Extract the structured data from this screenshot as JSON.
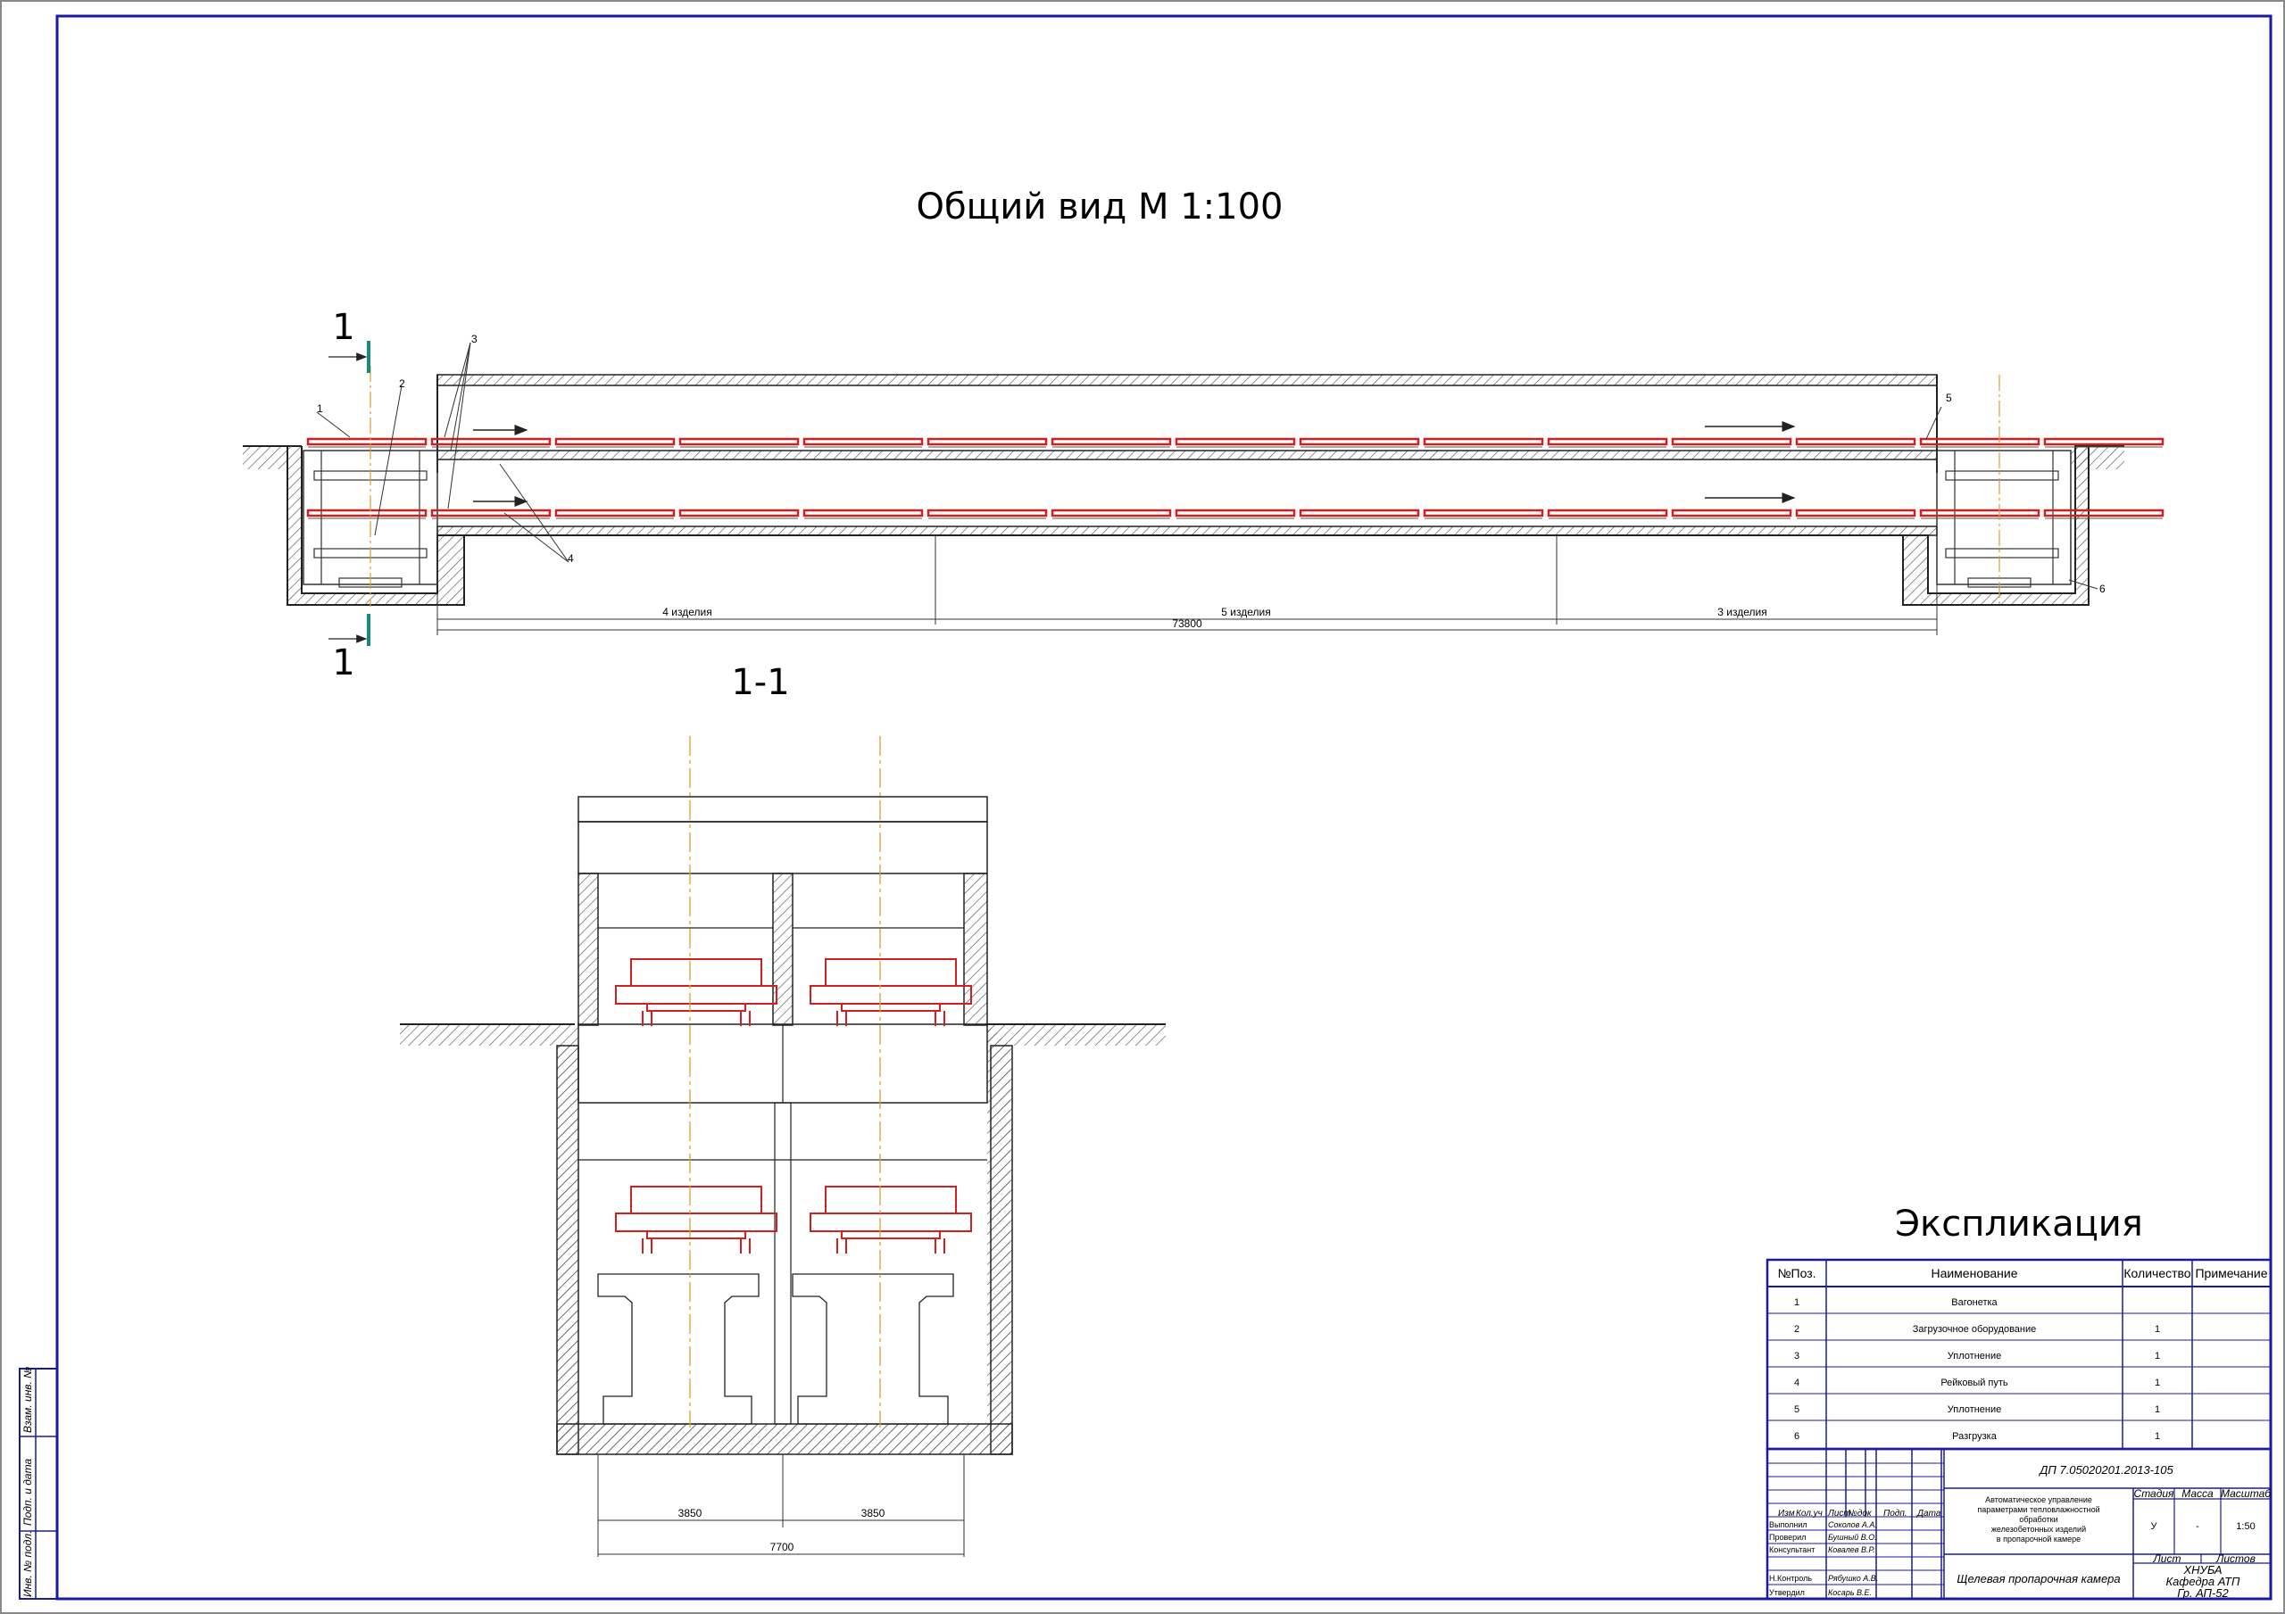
{
  "drawing": {
    "title": "Общий вид    М 1:100",
    "section_title": "1-1",
    "section_marker": "1",
    "segments": [
      "4 изделия",
      "5 изделия",
      "3 изделия"
    ],
    "overall_length": "73800",
    "leaders": [
      "1",
      "2",
      "3",
      "4",
      "5",
      "6"
    ],
    "section_dims": [
      "3850",
      "3850",
      "7700"
    ]
  },
  "explication": {
    "title": "Экспликация",
    "headers": [
      "№Поз.",
      "Наименование",
      "Количество",
      "Примечание"
    ],
    "rows": [
      {
        "pos": "1",
        "name": "Вагонетка",
        "qty": ""
      },
      {
        "pos": "2",
        "name": "Загрузочное оборудование",
        "qty": "1"
      },
      {
        "pos": "3",
        "name": "Уплотнение",
        "qty": "1"
      },
      {
        "pos": "4",
        "name": "Рейковый путь",
        "qty": "1"
      },
      {
        "pos": "5",
        "name": "Уплотнение",
        "qty": "1"
      },
      {
        "pos": "6",
        "name": "Разгрузка",
        "qty": "1"
      }
    ]
  },
  "title_block": {
    "code": "ДП 7.05020201.2013-105",
    "description": [
      "Автоматическое управление",
      "параметрами тепловлажностной",
      "обработки",
      "железобетонных изделий",
      "в пропарочной камере"
    ],
    "drawing_name": "Щелевая пропарочная камера",
    "col_heads": [
      "Изм",
      "Кол.уч",
      "Лист",
      "№док",
      "Подп.",
      "Дата"
    ],
    "roles": [
      {
        "role": "Выполнил",
        "name": "Соколов А.А."
      },
      {
        "role": "Проверил",
        "name": "Бушный В.О."
      },
      {
        "role": "Консультант",
        "name": "Ковалев В.Р."
      },
      {
        "role": "Н.Контроль",
        "name": "Рябушко А.В."
      },
      {
        "role": "Утвердил",
        "name": "Косарь В.Е."
      }
    ],
    "stage_head": "Стадия",
    "mass_head": "Масса",
    "scale_head": "Масштаб",
    "stage": "У",
    "mass": "-",
    "scale": "1:50",
    "sheet_head": "Лист",
    "sheets_head": "Листов",
    "org": [
      "ХНУБА",
      "Кафедра АТП",
      "Гр. АП-52"
    ]
  },
  "side_stamp": [
    "Инв. № подл.",
    "Подп. и дата",
    "Взам. инв. №"
  ]
}
